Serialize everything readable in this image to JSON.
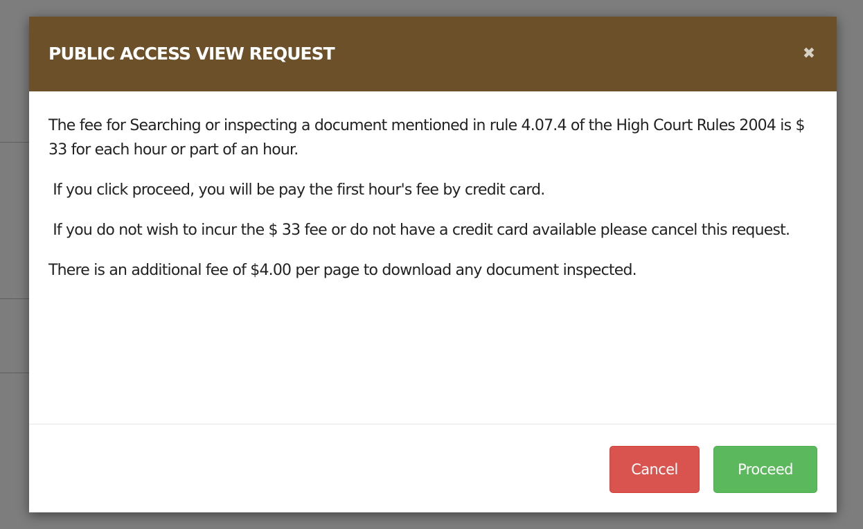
{
  "modal": {
    "title": "PUBLIC ACCESS VIEW  REQUEST",
    "close_symbol": "✖",
    "paragraphs": [
      "The fee for Searching or inspecting a document mentioned in rule 4.07.4 of the  High Court  Rules 2004 is $ 33 for each hour or part of an hour.",
      " If you click proceed, you will be pay the first hour's fee by credit card.",
      " If you do not wish to incur the $ 33 fee or do not have a credit card available please cancel this request.",
      "There is an additional fee of $4.00 per page to download any document inspected."
    ],
    "buttons": {
      "cancel_label": "Cancel",
      "proceed_label": "Proceed"
    }
  },
  "colors": {
    "header_bg": "#6b5029",
    "overlay": "#7d7d7d",
    "cancel": "#d9534f",
    "proceed": "#5cb85c"
  }
}
